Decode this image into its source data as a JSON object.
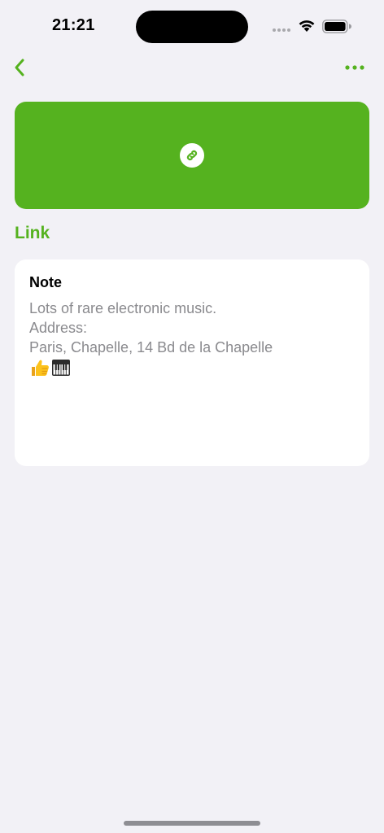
{
  "status_bar": {
    "time": "21:21"
  },
  "nav": {
    "back_icon": "chevron-left-icon",
    "more_icon": "ellipsis-icon"
  },
  "banner": {
    "icon": "link-icon",
    "color": "#55b21f"
  },
  "item": {
    "type_title": "Link"
  },
  "note": {
    "heading": "Note",
    "lines": [
      "Lots of rare electronic music.",
      "Address:",
      "Paris, Chapelle, 14 Bd de la Chapelle"
    ],
    "emojis": [
      "thumbs-up-icon",
      "piano-keys-icon"
    ]
  },
  "colors": {
    "accent": "#55b21f",
    "background": "#f2f1f6",
    "secondary_text": "#8a8a8e"
  }
}
